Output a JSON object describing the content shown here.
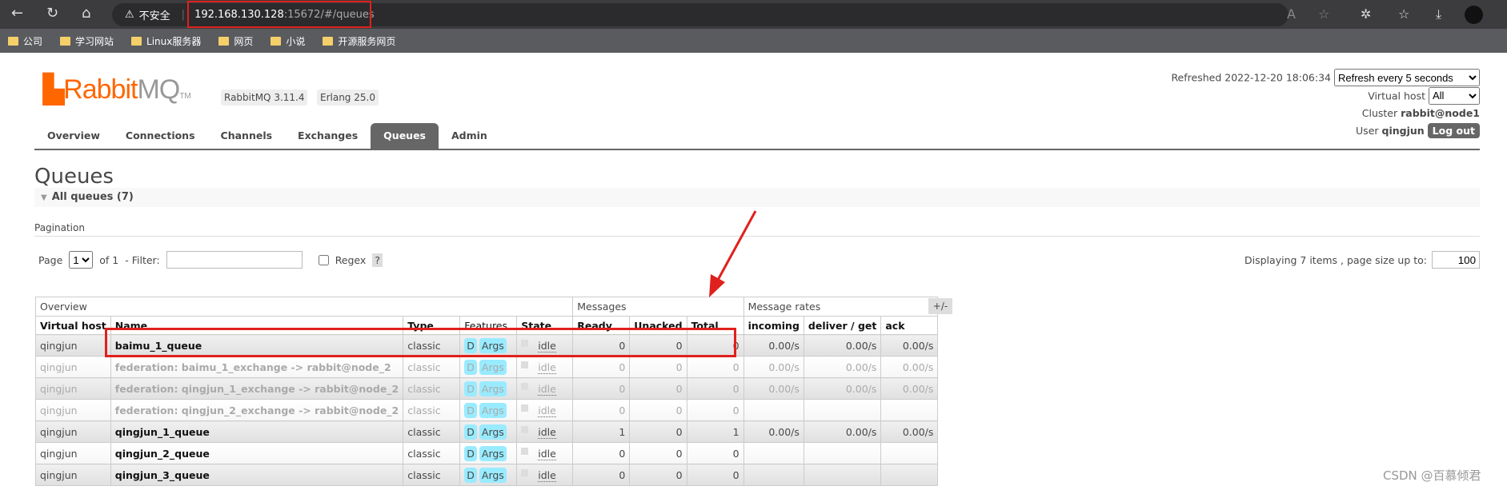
{
  "browser": {
    "security_label": "不安全",
    "url_host": "192.168.130.128",
    "url_rest": ":15672/#/queues",
    "bookmarks": [
      "公司",
      "学习网站",
      "Linux服务器",
      "网页",
      "小说",
      "开源服务网页"
    ]
  },
  "header": {
    "logo": "RabbitMQ",
    "logo_tm": "TM",
    "version": "RabbitMQ 3.11.4",
    "erlang": "Erlang 25.0",
    "refreshed_label": "Refreshed 2022-12-20 18:06:34",
    "refresh_option": "Refresh every 5 seconds",
    "vhost_label": "Virtual host",
    "vhost_value": "All",
    "cluster_label": "Cluster",
    "cluster_value": "rabbit@node1",
    "user_label": "User",
    "user_value": "qingjun",
    "logout": "Log out"
  },
  "tabs": [
    "Overview",
    "Connections",
    "Channels",
    "Exchanges",
    "Queues",
    "Admin"
  ],
  "active_tab": "Queues",
  "page": {
    "title": "Queues",
    "section": "All queues (7)",
    "pagination_label": "Pagination",
    "page_label": "Page",
    "page_value": "1",
    "of_label": "of 1",
    "filter_label": "- Filter:",
    "filter_value": "",
    "regex_label": "Regex",
    "help": "?",
    "displaying": "Displaying 7 items , page size up to:",
    "page_size": "100"
  },
  "table": {
    "groups": [
      "Overview",
      "Messages",
      "Message rates"
    ],
    "plus_minus": "+/-",
    "columns": [
      "Virtual host",
      "Name",
      "Type",
      "Features",
      "State",
      "Ready",
      "Unacked",
      "Total",
      "incoming",
      "deliver / get",
      "ack"
    ],
    "rows": [
      {
        "vhost": "qingjun",
        "name": "baimu_1_queue",
        "type": "classic",
        "f1": "D",
        "f2": "Args",
        "state": "idle",
        "ready": "0",
        "unacked": "0",
        "total": "0",
        "incoming": "0.00/s",
        "deliver": "0.00/s",
        "ack": "0.00/s"
      },
      {
        "vhost": "qingjun",
        "name": "federation: baimu_1_exchange -> rabbit@node_2",
        "type": "classic",
        "f1": "D",
        "f2": "Args",
        "state": "idle",
        "ready": "0",
        "unacked": "0",
        "total": "0",
        "incoming": "0.00/s",
        "deliver": "0.00/s",
        "ack": "0.00/s"
      },
      {
        "vhost": "qingjun",
        "name": "federation: qingjun_1_exchange -> rabbit@node_2",
        "type": "classic",
        "f1": "D",
        "f2": "Args",
        "state": "idle",
        "ready": "0",
        "unacked": "0",
        "total": "0",
        "incoming": "0.00/s",
        "deliver": "0.00/s",
        "ack": "0.00/s"
      },
      {
        "vhost": "qingjun",
        "name": "federation: qingjun_2_exchange -> rabbit@node_2",
        "type": "classic",
        "f1": "D",
        "f2": "Args",
        "state": "idle",
        "ready": "0",
        "unacked": "0",
        "total": "0",
        "incoming": "",
        "deliver": "",
        "ack": ""
      },
      {
        "vhost": "qingjun",
        "name": "qingjun_1_queue",
        "type": "classic",
        "f1": "D",
        "f2": "Args",
        "state": "idle",
        "ready": "1",
        "unacked": "0",
        "total": "1",
        "incoming": "0.00/s",
        "deliver": "0.00/s",
        "ack": "0.00/s"
      },
      {
        "vhost": "qingjun",
        "name": "qingjun_2_queue",
        "type": "classic",
        "f1": "D",
        "f2": "Args",
        "state": "idle",
        "ready": "0",
        "unacked": "0",
        "total": "0",
        "incoming": "",
        "deliver": "",
        "ack": ""
      },
      {
        "vhost": "qingjun",
        "name": "qingjun_3_queue",
        "type": "classic",
        "f1": "D",
        "f2": "Args",
        "state": "idle",
        "ready": "0",
        "unacked": "0",
        "total": "0",
        "incoming": "",
        "deliver": "",
        "ack": ""
      }
    ]
  },
  "watermark": "CSDN @百慕倾君",
  "colors": {
    "brand": "#ff6600",
    "highlight": "#e0201c",
    "feature_badge": "#99ebff",
    "active_tab": "#666666"
  }
}
